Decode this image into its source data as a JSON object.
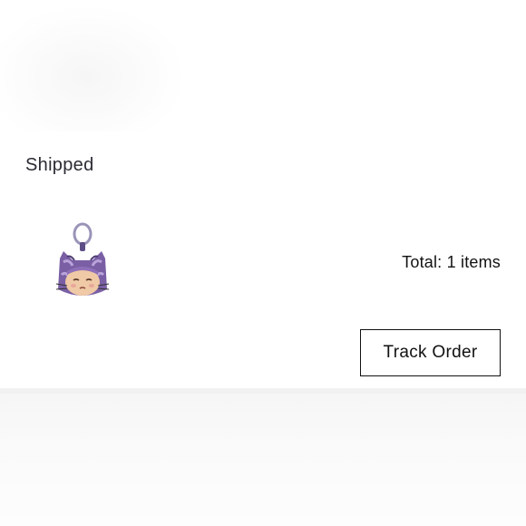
{
  "order": {
    "status": "Shipped",
    "total": "Total: 1 items",
    "track_label": "Track Order",
    "product_thumbnail": "purple-cat-plush-keychain"
  },
  "colors": {
    "text_dark": "#111111",
    "status_text": "#2b2b33",
    "plush_purple": "#7a5fa5",
    "divider": "#f1f1f1"
  }
}
